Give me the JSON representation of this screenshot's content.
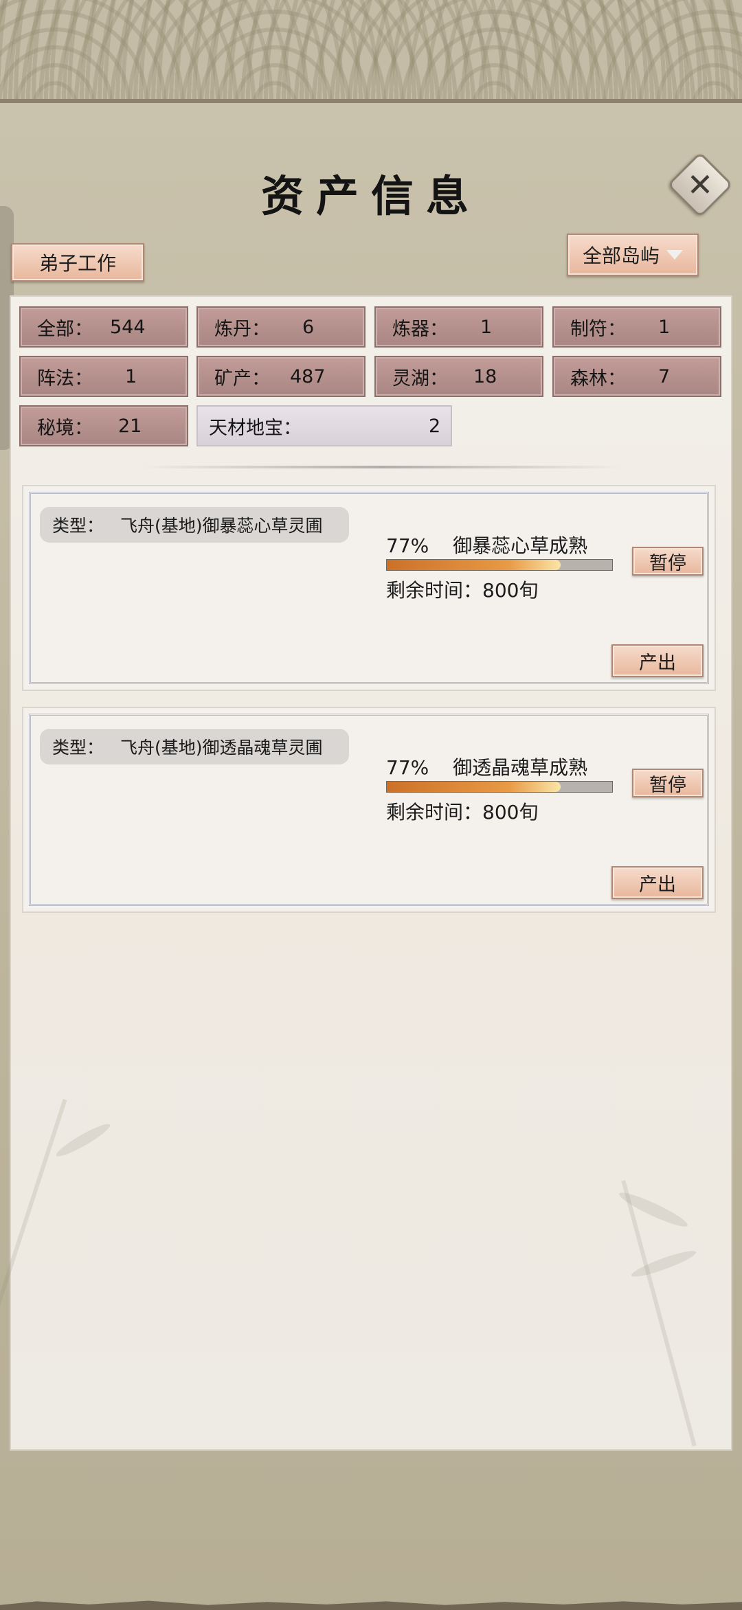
{
  "header": {
    "title": "资产信息"
  },
  "buttons": {
    "disciple_work": "弟子工作",
    "island_filter": "全部岛屿",
    "close": "✕"
  },
  "stats": [
    {
      "label": "全部：",
      "value": "544"
    },
    {
      "label": "炼丹：",
      "value": "6"
    },
    {
      "label": "炼器：",
      "value": "1"
    },
    {
      "label": "制符：",
      "value": "1"
    },
    {
      "label": "阵法：",
      "value": "1"
    },
    {
      "label": "矿产：",
      "value": "487"
    },
    {
      "label": "灵湖：",
      "value": "18"
    },
    {
      "label": "森林：",
      "value": "7"
    },
    {
      "label": "秘境：",
      "value": "21"
    },
    {
      "label": "天材地宝：",
      "value": "2"
    }
  ],
  "cards": [
    {
      "type_label": "类型：",
      "type_value": "飞舟(基地)御暴蕊心草灵圃",
      "percent": "77%",
      "progress": 0.77,
      "status": "御暴蕊心草成熟",
      "remaining": "剩余时间：800旬",
      "pause": "暂停",
      "output": "产出"
    },
    {
      "type_label": "类型：",
      "type_value": "飞舟(基地)御透晶魂草灵圃",
      "percent": "77%",
      "progress": 0.77,
      "status": "御透晶魂草成熟",
      "remaining": "剩余时间：800旬",
      "pause": "暂停",
      "output": "产出"
    }
  ]
}
